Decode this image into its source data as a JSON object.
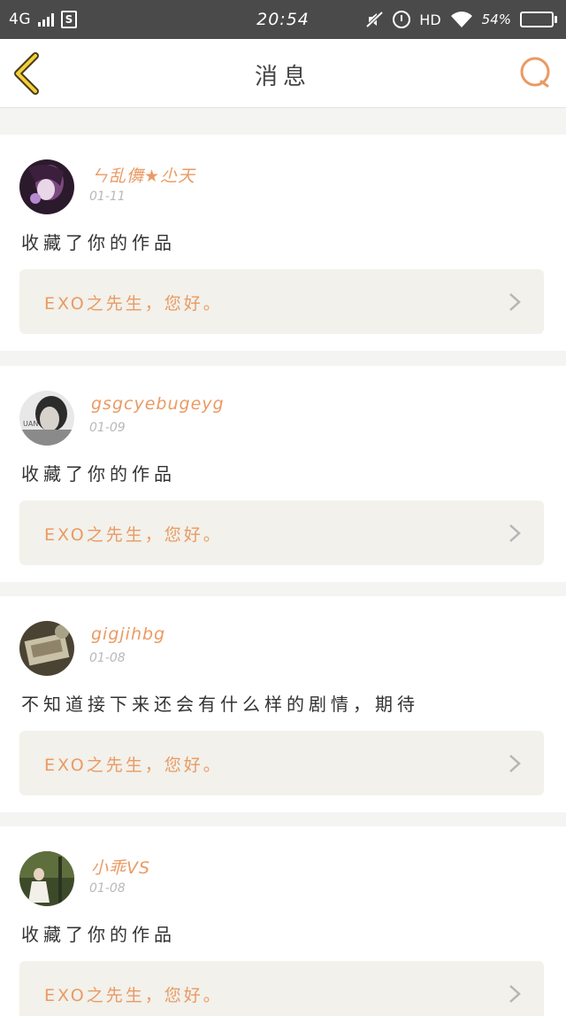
{
  "status_bar": {
    "network": "4G",
    "time": "20:54",
    "hd_label": "HD",
    "battery_percent": "54%",
    "battery_level": 0.54,
    "signal_icon": "signal-bars-icon",
    "sim_icon": "sim-card-icon",
    "mute_icon": "mute-icon",
    "alarm_icon": "alarm-icon",
    "wifi_icon": "wifi-icon"
  },
  "header": {
    "title": "消息",
    "back_icon": "chevron-left-icon",
    "search_icon": "search-icon",
    "accent_color": "#ea9a63"
  },
  "messages": [
    {
      "username": "ㄣ乱儛★尐天",
      "date": "01-11",
      "text": "收藏了你的作品",
      "work_title": "EXO之先生，您好。"
    },
    {
      "username": "gsgcyebugeyg",
      "date": "01-09",
      "text": "收藏了你的作品",
      "work_title": "EXO之先生，您好。"
    },
    {
      "username": "gigjihbg",
      "date": "01-08",
      "text": "不知道接下来还会有什么样的剧情，期待",
      "work_title": "EXO之先生，您好。"
    },
    {
      "username": "小乖VS",
      "date": "01-08",
      "text": "收藏了你的作品",
      "work_title": "EXO之先生，您好。"
    }
  ]
}
